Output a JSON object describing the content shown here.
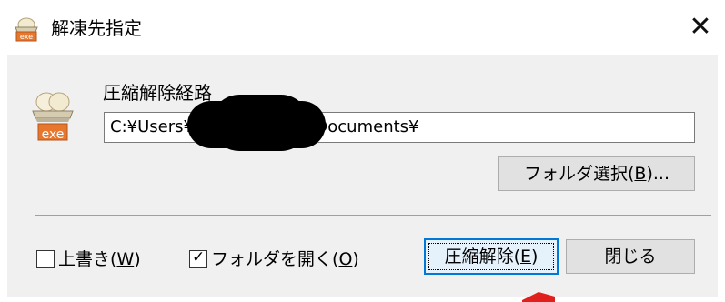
{
  "window": {
    "title": "解凍先指定",
    "close_symbol": "✕",
    "icon": "archive-exe-icon"
  },
  "main": {
    "path_label": "圧縮解除経路",
    "path_value_prefix": "C:¥Users¥",
    "path_value_suffix": "¥Documents¥",
    "path_redacted": true,
    "folder_button_label": "フォルダ選択",
    "folder_button_key": "B",
    "folder_button_suffix": "...",
    "exe_icon_text": "exe"
  },
  "options": {
    "overwrite_label": "上書き",
    "overwrite_key": "W",
    "overwrite_checked": false,
    "open_folder_label": "フォルダを開く",
    "open_folder_key": "O",
    "open_folder_checked": true,
    "check_mark": "✓"
  },
  "actions": {
    "extract_label": "圧縮解除",
    "extract_key": "E",
    "close_label": "閉じる"
  },
  "colors": {
    "focus_border": "#0078d7",
    "dialog_bg": "#f0f0f0",
    "annotation_red": "#e0201c"
  }
}
